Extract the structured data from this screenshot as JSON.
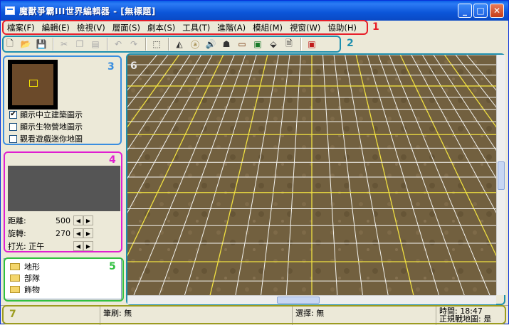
{
  "window": {
    "title": "魔獸爭霸III世界編輯器 - [無標題]",
    "minimize": "_",
    "maximize": "□",
    "close": "✕"
  },
  "menu": [
    "檔案(F)",
    "編輯(E)",
    "檢視(V)",
    "層面(S)",
    "劇本(S)",
    "工具(T)",
    "進階(A)",
    "模組(M)",
    "視窗(W)",
    "協助(H)"
  ],
  "annotations": {
    "menu": "1",
    "toolbar": "2",
    "minimap": "3",
    "camera": "4",
    "tree": "5",
    "viewport": "6",
    "status": "7"
  },
  "colors": {
    "annot_red": "#E8202A",
    "annot_teal": "#1E8FAE",
    "annot_blue": "#3A8EE0",
    "annot_magenta": "#E020D0",
    "annot_green": "#30C040",
    "annot_olive": "#9C9C20"
  },
  "toolbar": {
    "icons": [
      "new-file-icon",
      "open-folder-icon",
      "save-icon",
      "cut-icon",
      "copy-icon",
      "paste-icon",
      "undo-icon",
      "redo-icon",
      "select-icon",
      "terrain-icon",
      "doodad-icon",
      "sound-icon",
      "unit-icon",
      "region-icon",
      "camera-icon",
      "object-editor-icon",
      "import-icon",
      "test-map-icon"
    ]
  },
  "minimap_panel": {
    "options": [
      {
        "label": "顯示中立建築圖示",
        "checked": true
      },
      {
        "label": "顯示生物營地圖示",
        "checked": false
      },
      {
        "label": "觀看遊戲迷你地圖",
        "checked": false
      }
    ]
  },
  "camera_panel": {
    "distance_label": "距離:",
    "distance_value": "500",
    "rotation_label": "旋轉:",
    "rotation_value": "270",
    "lighting_label": "打光: 正午"
  },
  "tree": [
    "地形",
    "部隊",
    "飾物"
  ],
  "status": {
    "brush": "筆刷: 無",
    "selection": "選擇: 無",
    "time": "時間: 18:47",
    "melee": "正規戰地圖: 是"
  }
}
